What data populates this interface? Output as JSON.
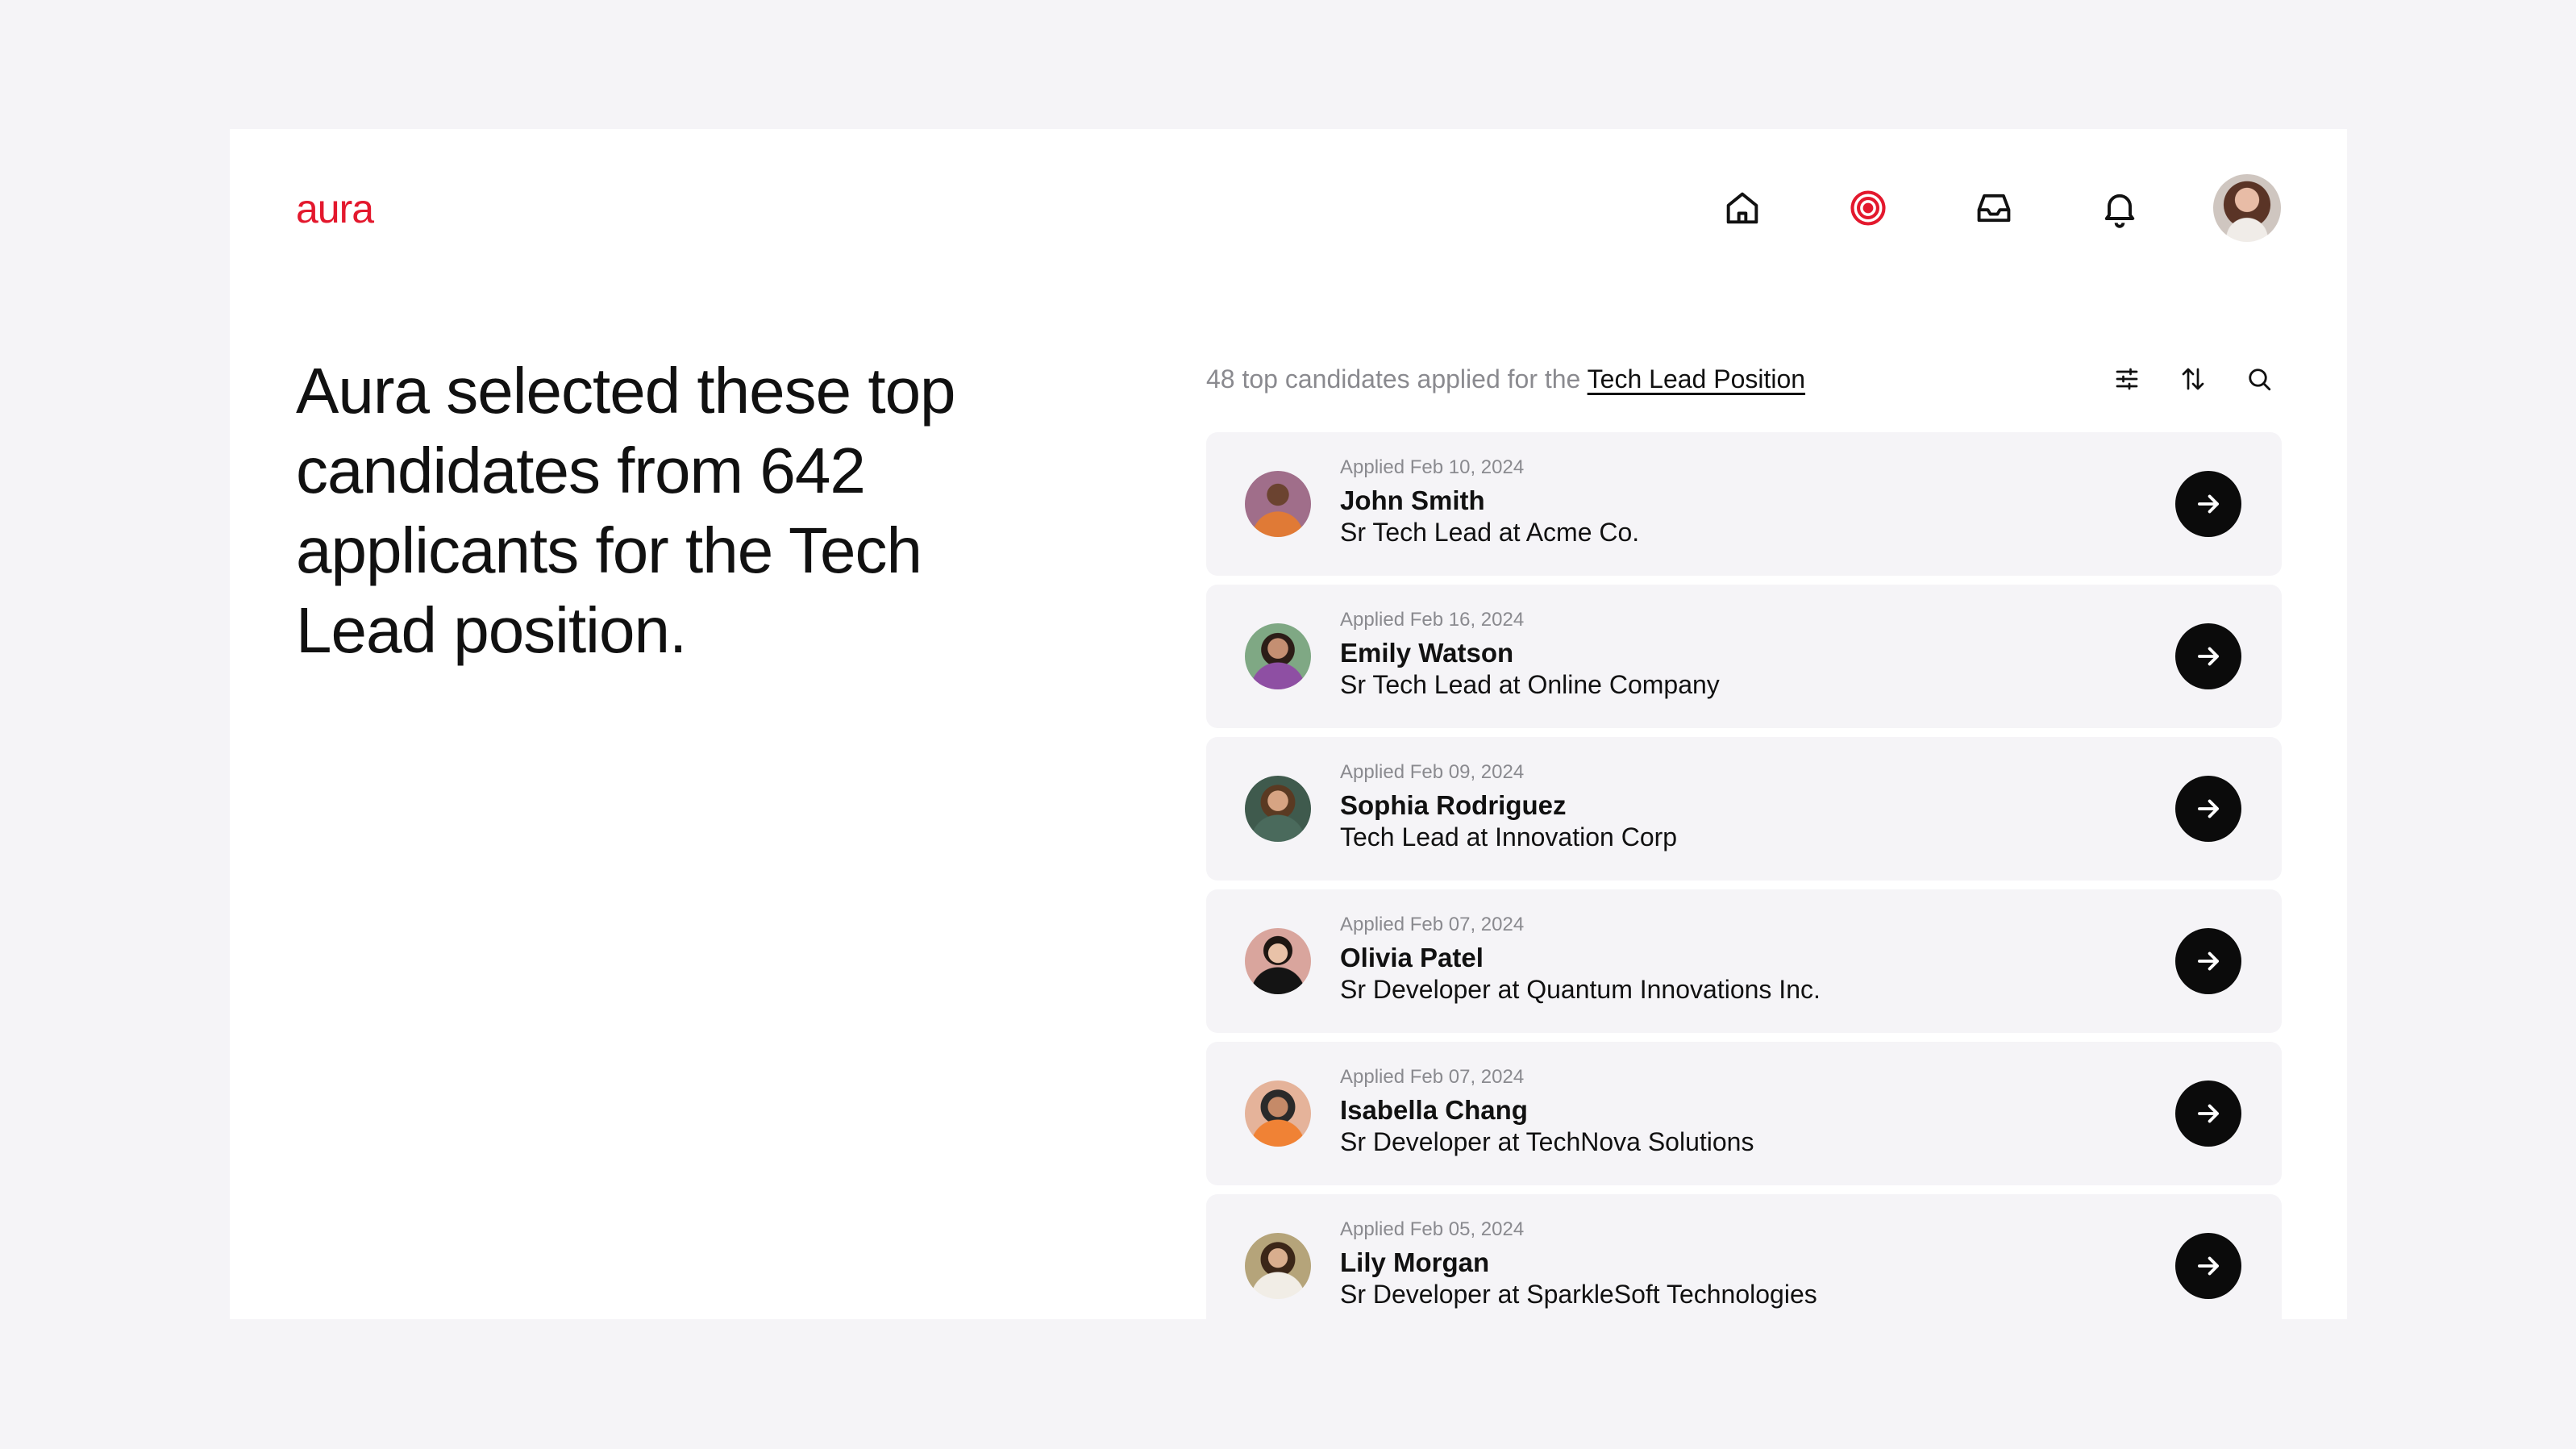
{
  "app": {
    "logo": "aura"
  },
  "nav": {
    "icons": [
      "home-icon",
      "target-icon",
      "inbox-icon",
      "bell-icon"
    ],
    "accent": "#e3182d"
  },
  "headline": "Aura selected these top candidates from 642 applicants for the Tech Lead position.",
  "list": {
    "summary_prefix": "48 top candidates applied for the ",
    "summary_link": "Tech Lead Position",
    "tools": [
      "filter-icon",
      "sort-icon",
      "search-icon"
    ]
  },
  "candidates": [
    {
      "applied": "Applied Feb 10, 2024",
      "name": "John Smith",
      "role": "Sr Tech Lead at Acme Co."
    },
    {
      "applied": "Applied Feb 16, 2024",
      "name": "Emily Watson",
      "role": "Sr Tech Lead at Online Company"
    },
    {
      "applied": "Applied Feb 09, 2024",
      "name": "Sophia Rodriguez",
      "role": "Tech Lead at Innovation Corp"
    },
    {
      "applied": "Applied Feb 07, 2024",
      "name": "Olivia Patel",
      "role": "Sr Developer at Quantum Innovations Inc."
    },
    {
      "applied": "Applied Feb 07, 2024",
      "name": "Isabella Chang",
      "role": "Sr Developer at TechNova Solutions"
    },
    {
      "applied": "Applied Feb 05, 2024",
      "name": "Lily Morgan",
      "role": "Sr Developer at SparkleSoft Technologies"
    }
  ],
  "colors": {
    "page_bg": "#f5f4f7",
    "row_bg": "#f5f4f7",
    "button_bg": "#0b0b0b"
  }
}
